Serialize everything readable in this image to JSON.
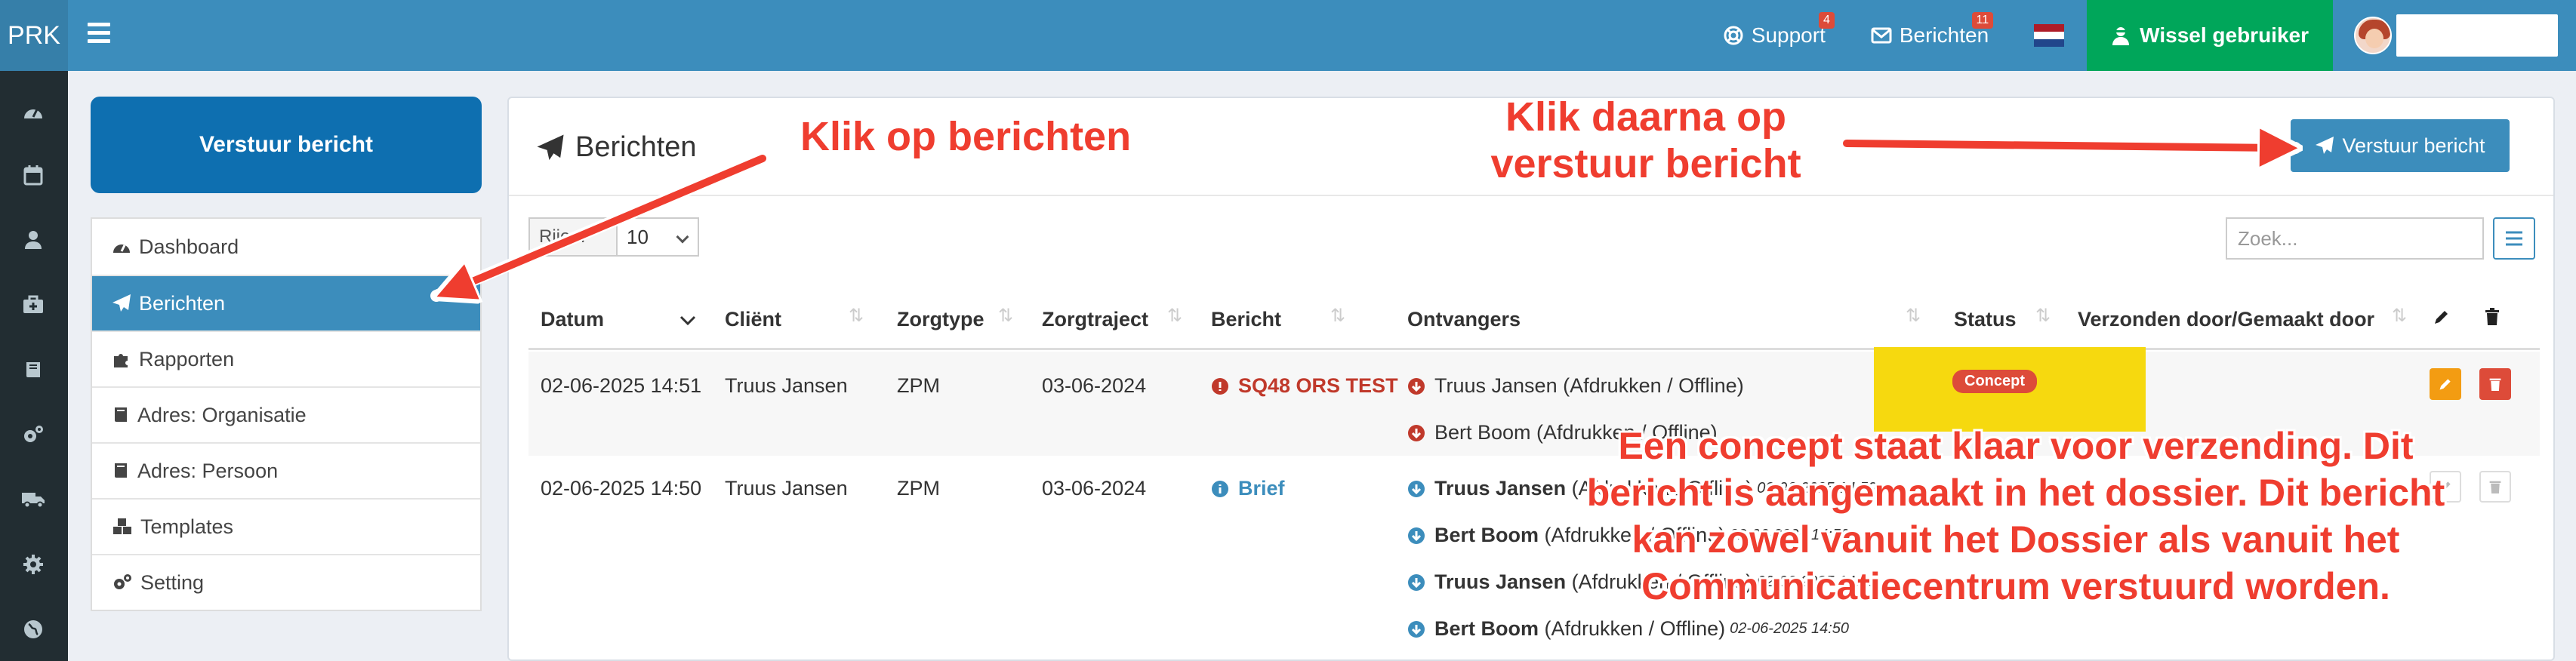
{
  "header": {
    "brand": "PRK",
    "support_label": "Support",
    "support_badge": "4",
    "messages_label": "Berichten",
    "messages_badge": "11",
    "switch_user_label": "Wissel gebruiker"
  },
  "sidebar": {
    "send_button": "Verstuur bericht",
    "items": [
      {
        "label": "Dashboard",
        "icon": "dashboard-icon"
      },
      {
        "label": "Berichten",
        "icon": "paper-plane-icon",
        "active": true
      },
      {
        "label": "Rapporten",
        "icon": "puzzle-icon"
      },
      {
        "label": "Adres: Organisatie",
        "icon": "book-icon"
      },
      {
        "label": "Adres: Persoon",
        "icon": "book-icon"
      },
      {
        "label": "Templates",
        "icon": "cubes-icon"
      },
      {
        "label": "Setting",
        "icon": "cogs-icon"
      }
    ]
  },
  "main": {
    "title": "Berichten",
    "send_button": "Verstuur bericht",
    "rows_label": "Rijen:",
    "rows_value": "10",
    "search_placeholder": "Zoek...",
    "columns": [
      "Datum",
      "Cliënt",
      "Zorgtype",
      "Zorgtraject",
      "Bericht",
      "Ontvangers",
      "Status",
      "Verzonden door/Gemaakt door"
    ],
    "rows": [
      {
        "datum": "02-06-2025 14:51",
        "client": "Truus Jansen",
        "zorgtype": "ZPM",
        "zorgtraject": "03-06-2024",
        "bericht": "SQ48 ORS TEST",
        "recipients": [
          {
            "name": "Truus Jansen (Afdrukken / Offline)"
          },
          {
            "name": "Bert Boom (Afdrukken / Offline)"
          }
        ],
        "status": "Concept"
      },
      {
        "datum": "02-06-2025 14:50",
        "client": "Truus Jansen",
        "zorgtype": "ZPM",
        "zorgtraject": "03-06-2024",
        "bericht": "Brief",
        "recipients": [
          {
            "name": "Truus Jansen",
            "channel": "(Afdrukken / Offline)",
            "time": "02-06-2025 14:50"
          },
          {
            "name": "Bert Boom",
            "channel": "(Afdrukken / Offline)",
            "time": "02-06-2025 14:50"
          },
          {
            "name": "Truus Jansen",
            "channel": "(Afdrukken / Offline)",
            "time": "02-06-2025 14:50"
          },
          {
            "name": "Bert Boom",
            "channel": "(Afdrukken / Offline)",
            "time": "02-06-2025 14:50"
          }
        ]
      }
    ]
  },
  "annotations": {
    "click_messages": "Klik op berichten",
    "click_send_line1": "Klik daarna op",
    "click_send_line2": "verstuur bericht",
    "concept_line1": "Een concept staat klaar voor verzending. Dit",
    "concept_line2": "bericht is aangemaakt in het dossier. Dit bericht",
    "concept_line3": "kan zowel vanuit het Dossier als vanuit het",
    "concept_line4": "Communicatiecentrum verstuurd worden."
  },
  "colors": {
    "topbar": "#3c8dbc",
    "rail": "#222d32",
    "active": "#3c8dbc",
    "success": "#00a65a",
    "danger": "#dd4b39",
    "warning": "#f39c12",
    "annotation": "#ef3d2f",
    "highlight": "#f6d90f"
  }
}
